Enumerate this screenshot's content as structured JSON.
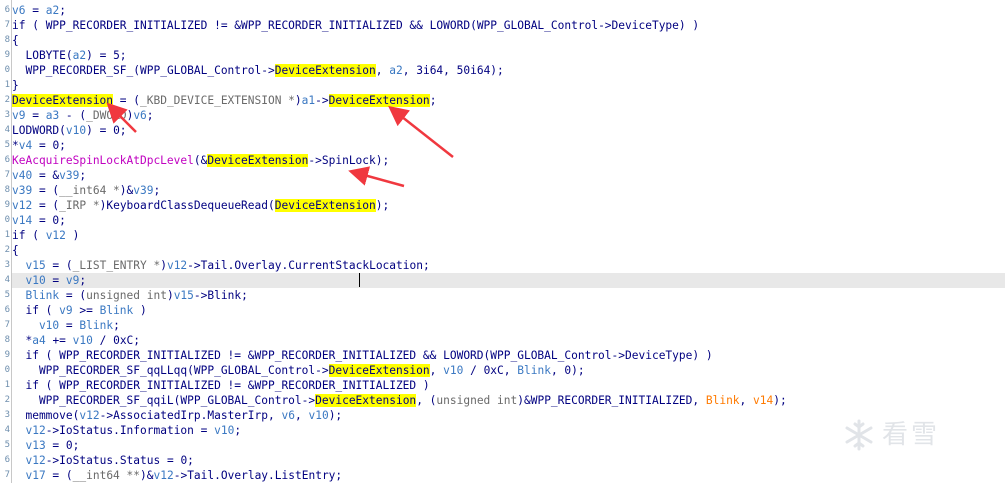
{
  "editor": {
    "caret_line": 18,
    "lines": [
      [
        [
          "v6",
          "var"
        ],
        [
          " = ",
          "plain"
        ],
        [
          "a2",
          "var"
        ],
        [
          ";",
          "plain"
        ]
      ],
      [
        [
          "if ( ",
          "kw"
        ],
        [
          "WPP_RECORDER_INITIALIZED",
          "plain"
        ],
        [
          " != &",
          "plain"
        ],
        [
          "WPP_RECORDER_INITIALIZED",
          "plain"
        ],
        [
          " && ",
          "plain"
        ],
        [
          "LOWORD",
          "func"
        ],
        [
          "(",
          "plain"
        ],
        [
          "WPP_GLOBAL_Control",
          "plain"
        ],
        [
          "->",
          "plain"
        ],
        [
          "DeviceType",
          "plain"
        ],
        [
          ") )",
          "plain"
        ]
      ],
      [
        [
          "{",
          "plain"
        ]
      ],
      [
        [
          "  LOBYTE",
          "func"
        ],
        [
          "(",
          "plain"
        ],
        [
          "a2",
          "var"
        ],
        [
          ") = 5;",
          "plain"
        ]
      ],
      [
        [
          "  WPP_RECORDER_SF_",
          "func"
        ],
        [
          "(",
          "plain"
        ],
        [
          "WPP_GLOBAL_Control",
          "plain"
        ],
        [
          "->",
          "plain"
        ],
        [
          "DeviceExtension",
          "hl"
        ],
        [
          ", ",
          "plain"
        ],
        [
          "a2",
          "var"
        ],
        [
          ", 3i64, 50i64);",
          "plain"
        ]
      ],
      [
        [
          "}",
          "plain"
        ]
      ],
      [
        [
          "DeviceExtension",
          "hl"
        ],
        [
          " = (",
          "plain"
        ],
        [
          "_KBD_DEVICE_EXTENSION *",
          "type"
        ],
        [
          ")",
          "plain"
        ],
        [
          "a1",
          "var"
        ],
        [
          "->",
          "plain"
        ],
        [
          "DeviceExtension",
          "hl"
        ],
        [
          ";",
          "plain"
        ]
      ],
      [
        [
          "v9",
          "var"
        ],
        [
          " = ",
          "plain"
        ],
        [
          "a3",
          "var"
        ],
        [
          " - (",
          "plain"
        ],
        [
          "_DWORD",
          "type"
        ],
        [
          ")",
          "plain"
        ],
        [
          "v6",
          "var"
        ],
        [
          ";",
          "plain"
        ]
      ],
      [
        [
          "LODWORD",
          "func"
        ],
        [
          "(",
          "plain"
        ],
        [
          "v10",
          "var"
        ],
        [
          ") = 0;",
          "plain"
        ]
      ],
      [
        [
          "*",
          "plain"
        ],
        [
          "v4",
          "var"
        ],
        [
          " = 0;",
          "plain"
        ]
      ],
      [
        [
          "KeAcquireSpinLockAtDpcLevel",
          "import"
        ],
        [
          "(&",
          "plain"
        ],
        [
          "DeviceExtension",
          "hl"
        ],
        [
          "->",
          "plain"
        ],
        [
          "SpinLock",
          "plain"
        ],
        [
          ");",
          "plain"
        ]
      ],
      [
        [
          "v40",
          "var"
        ],
        [
          " = &",
          "plain"
        ],
        [
          "v39",
          "var"
        ],
        [
          ";",
          "plain"
        ]
      ],
      [
        [
          "v39",
          "var"
        ],
        [
          " = (",
          "plain"
        ],
        [
          "__int64 *",
          "type"
        ],
        [
          ")&",
          "plain"
        ],
        [
          "v39",
          "var"
        ],
        [
          ";",
          "plain"
        ]
      ],
      [
        [
          "v12",
          "var"
        ],
        [
          " = (",
          "plain"
        ],
        [
          "_IRP *",
          "type"
        ],
        [
          ")",
          "plain"
        ],
        [
          "KeyboardClassDequeueRead",
          "func"
        ],
        [
          "(",
          "plain"
        ],
        [
          "DeviceExtension",
          "hl"
        ],
        [
          ");",
          "plain"
        ]
      ],
      [
        [
          "v14",
          "var"
        ],
        [
          " = 0;",
          "plain"
        ]
      ],
      [
        [
          "if ( ",
          "kw"
        ],
        [
          "v12",
          "var"
        ],
        [
          " )",
          "plain"
        ]
      ],
      [
        [
          "{",
          "plain"
        ]
      ],
      [
        [
          "  v15",
          "var"
        ],
        [
          " = (",
          "plain"
        ],
        [
          "_LIST_ENTRY *",
          "type"
        ],
        [
          ")",
          "plain"
        ],
        [
          "v12",
          "var"
        ],
        [
          "->",
          "plain"
        ],
        [
          "Tail",
          "plain"
        ],
        [
          ".",
          "plain"
        ],
        [
          "Overlay",
          "plain"
        ],
        [
          ".",
          "plain"
        ],
        [
          "CurrentStackLocation",
          "plain"
        ],
        [
          ";",
          "plain"
        ]
      ],
      [
        [
          "  v10",
          "var"
        ],
        [
          " = ",
          "plain"
        ],
        [
          "v9",
          "var"
        ],
        [
          ";",
          "plain"
        ]
      ],
      [
        [
          "  Blink",
          "var"
        ],
        [
          " = (",
          "plain"
        ],
        [
          "unsigned int",
          "type"
        ],
        [
          ")",
          "plain"
        ],
        [
          "v15",
          "var"
        ],
        [
          "->",
          "plain"
        ],
        [
          "Blink",
          "plain"
        ],
        [
          ";",
          "plain"
        ]
      ],
      [
        [
          "  if ( ",
          "kw"
        ],
        [
          "v9",
          "var"
        ],
        [
          " >= ",
          "plain"
        ],
        [
          "Blink",
          "var"
        ],
        [
          " )",
          "plain"
        ]
      ],
      [
        [
          "    v10",
          "var"
        ],
        [
          " = ",
          "plain"
        ],
        [
          "Blink",
          "var"
        ],
        [
          ";",
          "plain"
        ]
      ],
      [
        [
          "  *",
          "plain"
        ],
        [
          "a4",
          "var"
        ],
        [
          " += ",
          "plain"
        ],
        [
          "v10",
          "var"
        ],
        [
          " / 0xC;",
          "plain"
        ]
      ],
      [
        [
          "  if ( ",
          "kw"
        ],
        [
          "WPP_RECORDER_INITIALIZED",
          "plain"
        ],
        [
          " != &",
          "plain"
        ],
        [
          "WPP_RECORDER_INITIALIZED",
          "plain"
        ],
        [
          " && ",
          "plain"
        ],
        [
          "LOWORD",
          "func"
        ],
        [
          "(",
          "plain"
        ],
        [
          "WPP_GLOBAL_Control",
          "plain"
        ],
        [
          "->",
          "plain"
        ],
        [
          "DeviceType",
          "plain"
        ],
        [
          ") )",
          "plain"
        ]
      ],
      [
        [
          "    WPP_RECORDER_SF_qqLLqq",
          "func"
        ],
        [
          "(",
          "plain"
        ],
        [
          "WPP_GLOBAL_Control",
          "plain"
        ],
        [
          "->",
          "plain"
        ],
        [
          "DeviceExtension",
          "hl"
        ],
        [
          ", ",
          "plain"
        ],
        [
          "v10",
          "var"
        ],
        [
          " / 0xC, ",
          "plain"
        ],
        [
          "Blink",
          "var"
        ],
        [
          ", 0);",
          "plain"
        ]
      ],
      [
        [
          "  if ( ",
          "kw"
        ],
        [
          "WPP_RECORDER_INITIALIZED",
          "plain"
        ],
        [
          " != &",
          "plain"
        ],
        [
          "WPP_RECORDER_INITIALIZED",
          "plain"
        ],
        [
          " )",
          "plain"
        ]
      ],
      [
        [
          "    WPP_RECORDER_SF_qqiL",
          "func"
        ],
        [
          "(",
          "plain"
        ],
        [
          "WPP_GLOBAL_Control",
          "plain"
        ],
        [
          "->",
          "plain"
        ],
        [
          "DeviceExtension",
          "hl"
        ],
        [
          ", (",
          "plain"
        ],
        [
          "unsigned int",
          "type"
        ],
        [
          ")&",
          "plain"
        ],
        [
          "WPP_RECORDER_INITIALIZED",
          "plain"
        ],
        [
          ", ",
          "plain"
        ],
        [
          "Blink",
          "warn"
        ],
        [
          ", ",
          "plain"
        ],
        [
          "v14",
          "warn"
        ],
        [
          ");",
          "plain"
        ]
      ],
      [
        [
          "  memmove",
          "func"
        ],
        [
          "(",
          "plain"
        ],
        [
          "v12",
          "var"
        ],
        [
          "->",
          "plain"
        ],
        [
          "AssociatedIrp",
          "plain"
        ],
        [
          ".",
          "plain"
        ],
        [
          "MasterIrp",
          "plain"
        ],
        [
          ", ",
          "plain"
        ],
        [
          "v6",
          "var"
        ],
        [
          ", ",
          "plain"
        ],
        [
          "v10",
          "var"
        ],
        [
          ");",
          "plain"
        ]
      ],
      [
        [
          "  v12",
          "var"
        ],
        [
          "->",
          "plain"
        ],
        [
          "IoStatus",
          "plain"
        ],
        [
          ".",
          "plain"
        ],
        [
          "Information",
          "plain"
        ],
        [
          " = ",
          "plain"
        ],
        [
          "v10",
          "var"
        ],
        [
          ";",
          "plain"
        ]
      ],
      [
        [
          "  v13",
          "var"
        ],
        [
          " = 0;",
          "plain"
        ]
      ],
      [
        [
          "  v12",
          "var"
        ],
        [
          "->",
          "plain"
        ],
        [
          "IoStatus",
          "plain"
        ],
        [
          ".",
          "plain"
        ],
        [
          "Status",
          "plain"
        ],
        [
          " = 0;",
          "plain"
        ]
      ],
      [
        [
          "  v17",
          "var"
        ],
        [
          " = (",
          "plain"
        ],
        [
          "__int64 **",
          "type"
        ],
        [
          ")&",
          "plain"
        ],
        [
          "v12",
          "var"
        ],
        [
          "->",
          "plain"
        ],
        [
          "Tail",
          "plain"
        ],
        [
          ".",
          "plain"
        ],
        [
          "Overlay",
          "plain"
        ],
        [
          ".",
          "plain"
        ],
        [
          "ListEntry",
          "plain"
        ],
        [
          ";",
          "plain"
        ]
      ]
    ],
    "gutter_marks": [
      "6",
      "7",
      "8",
      "9",
      "0",
      "1",
      "2",
      "3",
      "4",
      "5",
      "6",
      "7",
      "8",
      "9",
      "0",
      "1",
      "2",
      "3",
      "4",
      "5",
      "6",
      "7",
      "8",
      "9",
      "0",
      "1",
      "2",
      "3",
      "4",
      "5",
      "6",
      "7"
    ],
    "arrow_color": "#f0383f"
  },
  "watermark": {
    "icon": "snowflake-icon",
    "text": "看雪"
  }
}
